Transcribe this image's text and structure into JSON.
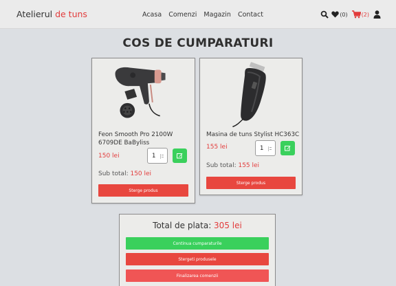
{
  "navbar": {
    "brand_main": "Atelierul ",
    "brand_accent": "de tuns",
    "links": [
      "Acasa",
      "Comenzi",
      "Magazin",
      "Contact"
    ],
    "wishlist_count": "(0)",
    "cart_count": "(2)",
    "icons": [
      "search-icon",
      "heart-icon",
      "cart-icon",
      "user-icon"
    ],
    "accent_color": "#e23b3b"
  },
  "page": {
    "title": "COS DE CUMPARATURI"
  },
  "products": [
    {
      "name_line1": "Feon Smooth Pro 2100W",
      "name_line2": "6709DE BaByliss",
      "price": "150 lei",
      "quantity": "1",
      "subtotal_label": "Sub total: ",
      "subtotal_value": "150 lei",
      "delete_label": "Sterge produs"
    },
    {
      "name_line1": "Masina de tuns Stylist HC363C",
      "price": "155 lei",
      "quantity": "1",
      "subtotal_label": "Sub total: ",
      "subtotal_value": "155 lei",
      "delete_label": "Sterge produs"
    }
  ],
  "summary": {
    "total_label": "Total de plata: ",
    "total_value": "305 lei",
    "continue_label": "Continua cumparaturile",
    "clear_label": "Stergeti produsele",
    "checkout_label": "Finalizarea comenzii"
  },
  "colors": {
    "green": "#3ad05c",
    "red": "#e8473f",
    "background": "#dcdfe3"
  }
}
